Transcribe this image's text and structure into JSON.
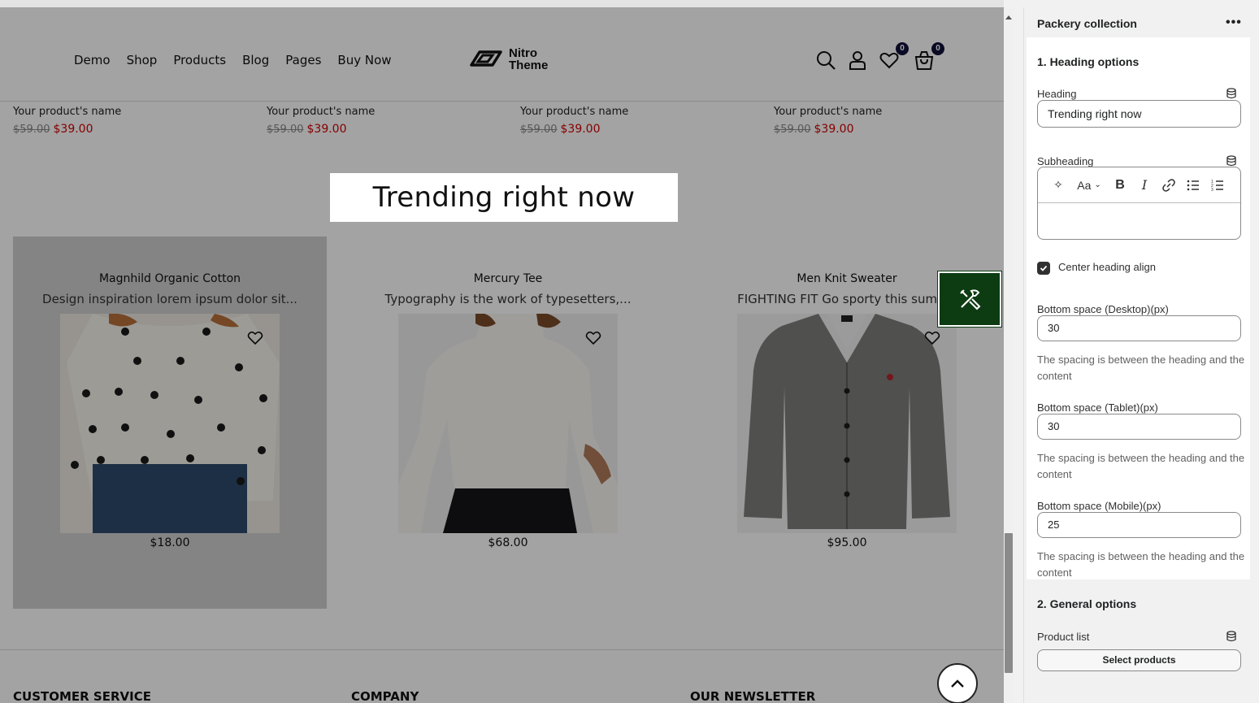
{
  "header": {
    "nav": [
      "Demo",
      "Shop",
      "Products",
      "Blog",
      "Pages",
      "Buy Now"
    ],
    "logo_line1": "Nitro",
    "logo_line2": "Theme",
    "wishlist_count": "0",
    "cart_count": "0",
    "icons": [
      "search-icon",
      "account-icon",
      "heart-icon",
      "cart-icon"
    ]
  },
  "product_row": [
    {
      "name": "Your product's name",
      "old_price": "$59.00",
      "price": "$39.00"
    },
    {
      "name": "Your product's name",
      "old_price": "$59.00",
      "price": "$39.00"
    },
    {
      "name": "Your product's name",
      "old_price": "$59.00",
      "price": "$39.00"
    },
    {
      "name": "Your product's name",
      "old_price": "$59.00",
      "price": "$39.00"
    }
  ],
  "section_heading": "Trending right now",
  "cards": [
    {
      "title": "Magnhild Organic Cotton",
      "desc": "Design inspiration lorem ipsum dolor sit...",
      "price": "$18.00"
    },
    {
      "title": "Mercury Tee",
      "desc": "Typography is the work of typesetters,...",
      "price": "$68.00"
    },
    {
      "title": "Men Knit Sweater",
      "desc": "FIGHTING FIT Go sporty this summe",
      "price": "$95.00"
    }
  ],
  "footer": {
    "col1": "CUSTOMER SERVICE",
    "col2": "COMPANY",
    "col3": "OUR NEWSLETTER"
  },
  "panel": {
    "title": "Packery collection",
    "more": "•••",
    "section1_title": "1. Heading options",
    "heading_label": "Heading",
    "heading_value": "Trending right now",
    "subheading_label": "Subheading",
    "rte_font": "Aa",
    "center_align_label": "Center heading align",
    "center_align_checked": true,
    "desktop_label": "Bottom space (Desktop)(px)",
    "desktop_value": "30",
    "tablet_label": "Bottom space (Tablet)(px)",
    "tablet_value": "30",
    "mobile_label": "Bottom space (Mobile)(px)",
    "mobile_value": "25",
    "help_text": "The spacing is between the heading and the content",
    "section2_title": "2. General options",
    "product_list_label": "Product list",
    "select_products": "Select products"
  },
  "colors": {
    "sale_red": "#d20000",
    "badge_navy": "#10113a",
    "customize_green": "#0d3b12"
  }
}
